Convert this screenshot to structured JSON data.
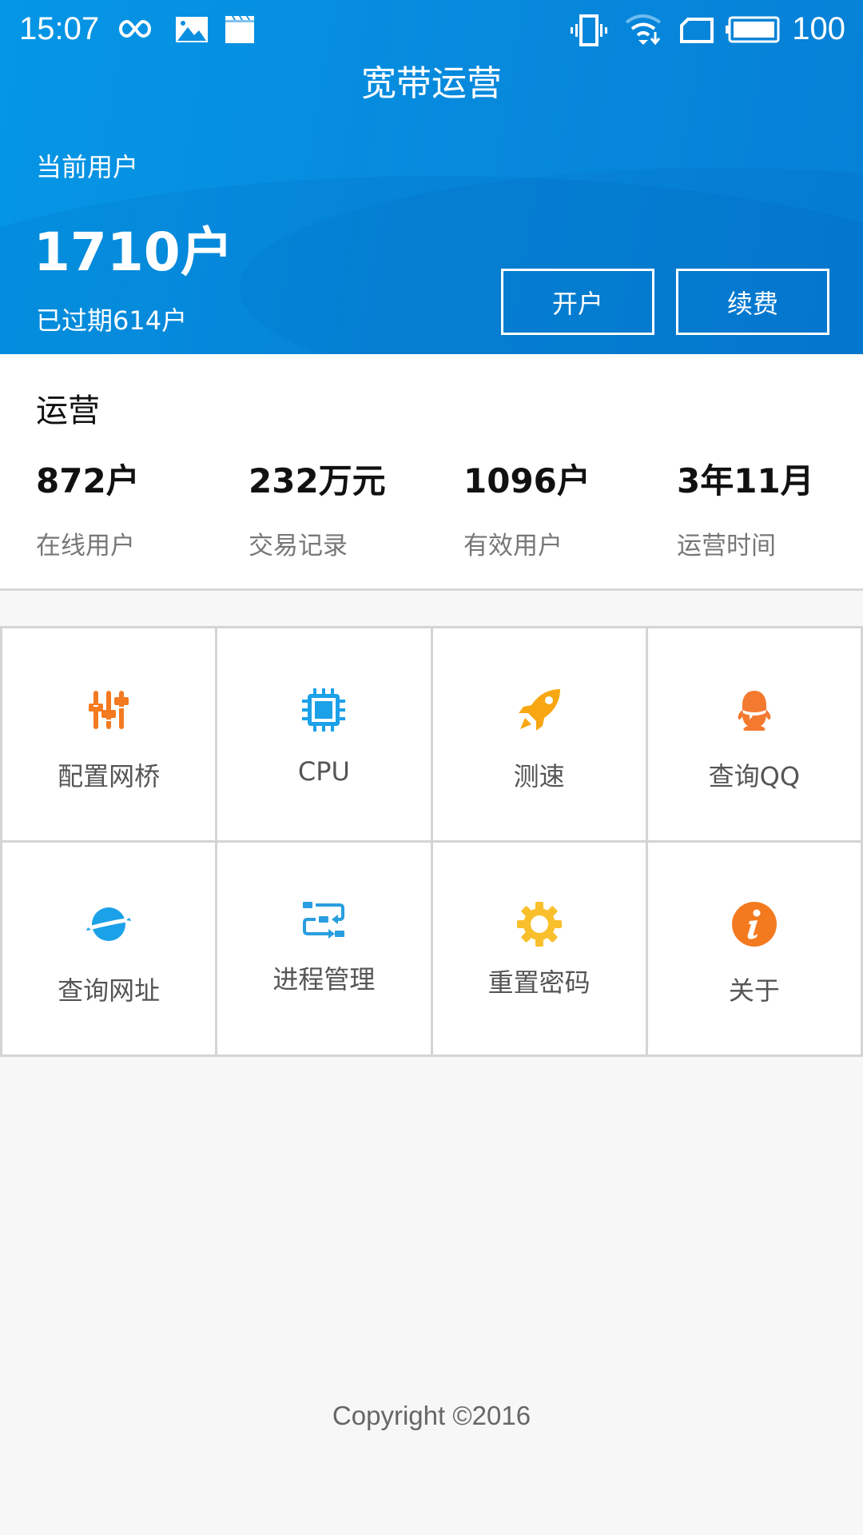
{
  "status_bar": {
    "time": "15:07",
    "left_icons": [
      "infinity-icon",
      "image-icon",
      "clapperboard-icon"
    ],
    "right_icons": [
      "vibrate-icon",
      "wifi-icon",
      "sim-icon",
      "battery-icon"
    ],
    "battery": "100"
  },
  "header": {
    "title": "宽带运营",
    "current_users_label": "当前用户",
    "current_users_value": "1710户",
    "expired": "已过期614户",
    "buttons": [
      {
        "label": "开户"
      },
      {
        "label": "续费"
      }
    ]
  },
  "operations": {
    "title": "运营",
    "stats": [
      {
        "value": "872户",
        "label": "在线用户"
      },
      {
        "value": "232万元",
        "label": "交易记录"
      },
      {
        "value": "1096户",
        "label": "有效用户"
      },
      {
        "value": "3年11月",
        "label": "运营时间"
      }
    ]
  },
  "grid": [
    {
      "label": "配置网桥",
      "icon": "sliders-icon",
      "color": "#f47a20"
    },
    {
      "label": "CPU",
      "icon": "cpu-icon",
      "color": "#1ba1e8"
    },
    {
      "label": "测速",
      "icon": "rocket-icon",
      "color": "#f8a712"
    },
    {
      "label": "查询QQ",
      "icon": "qq-penguin-icon",
      "color": "#f47a30"
    },
    {
      "label": "查询网址",
      "icon": "planet-icon",
      "color": "#1ba1e8"
    },
    {
      "label": "进程管理",
      "icon": "process-flow-icon",
      "color": "#2a9ee0"
    },
    {
      "label": "重置密码",
      "icon": "gear-icon",
      "color": "#f9bf2c"
    },
    {
      "label": "关于",
      "icon": "info-icon",
      "color": "#f47a20"
    }
  ],
  "footer": {
    "copyright": "Copyright ©2016"
  }
}
